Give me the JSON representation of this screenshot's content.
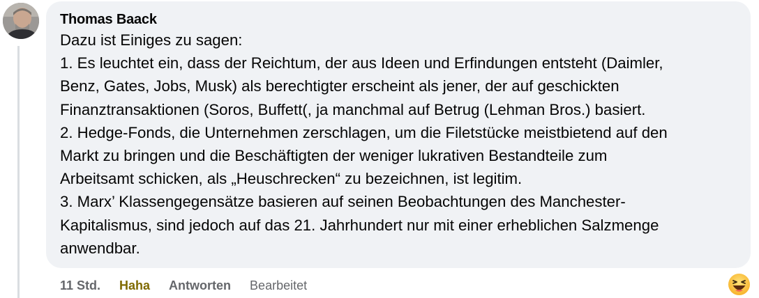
{
  "comment": {
    "author": "Thomas Baack",
    "lines": [
      "Dazu ist Einiges zu sagen:",
      "1. Es leuchtet ein, dass der Reichtum, der aus Ideen und Erfindungen entsteht (Daimler,",
      "Benz, Gates, Jobs, Musk) als berechtigter erscheint als jener, der auf geschickten",
      "Finanztransaktionen (Soros, Buffett(, ja manchmal auf Betrug (Lehman Bros.) basiert.",
      "2. Hedge-Fonds, die Unternehmen zerschlagen, um die Filetstücke meistbietend auf den",
      "Markt zu bringen und die Beschäftigten der weniger lukrativen Bestandteile zum",
      "Arbeitsamt schicken, als „Heuschrecken“ zu bezeichnen, ist legitim.",
      "3. Marx’ Klassengegensätze basieren auf seinen Beobachtungen des Manchester-",
      "Kapitalismus, sind jedoch auf das 21. Jahrhundert nur mit einer erheblichen Salzmenge",
      "anwendbar."
    ]
  },
  "actions": {
    "time": "11 Std.",
    "reaction_label": "Haha",
    "reply_label": "Antworten",
    "edited_label": "Bearbeitet"
  },
  "icons": {
    "avatar": "user-avatar-photo",
    "reaction": "haha-emoji-icon"
  },
  "colors": {
    "bubble": "#f0f2f5",
    "text": "#050505",
    "meta": "#65676b",
    "haha": "#7f6a00"
  }
}
